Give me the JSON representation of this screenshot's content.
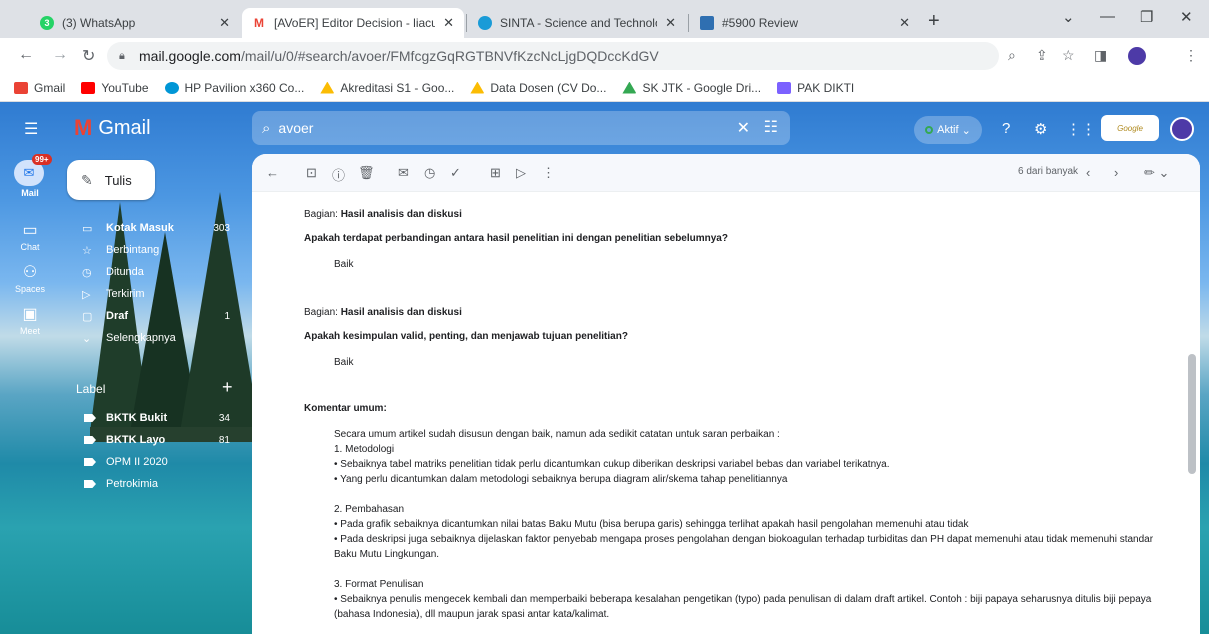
{
  "browser": {
    "tabs": [
      {
        "title": "(3) WhatsApp",
        "favicon": "whatsapp-icon",
        "color": "#25d366"
      },
      {
        "title": "[AVoER] Editor Decision - liacund",
        "favicon": "gmail-icon",
        "color": "#ea4335",
        "active": true
      },
      {
        "title": "SINTA - Science and Technology",
        "favicon": "sinta-icon",
        "color": "#1a9bd7"
      },
      {
        "title": "#5900 Review",
        "favicon": "review-icon",
        "color": "#2f6fb1"
      }
    ],
    "url_host": "mail.google.com",
    "url_path": "/mail/u/0/#search/avoer/FMfcgzGqRGTBNVfKzcNcLjgDQDccKdGV",
    "bookmarks": [
      {
        "label": "Gmail",
        "color": "#ea4335"
      },
      {
        "label": "YouTube",
        "color": "#ff0000"
      },
      {
        "label": "HP Pavilion x360 Co...",
        "color": "#0096d6"
      },
      {
        "label": "Akreditasi S1 - Goo...",
        "color": "#fbbc04"
      },
      {
        "label": "Data Dosen (CV Do...",
        "color": "#fbbc04"
      },
      {
        "label": "SK JTK - Google Dri...",
        "color": "#34a853"
      },
      {
        "label": "PAK DIKTI",
        "color": "#7b61ff"
      }
    ]
  },
  "gmail": {
    "brand": "Gmail",
    "search_query": "avoer",
    "status": "Aktif",
    "compose": "Tulis",
    "rail": {
      "mail": "Mail",
      "mail_count": "99+",
      "chat": "Chat",
      "spaces": "Spaces",
      "meet": "Meet"
    },
    "nav": [
      {
        "label": "Kotak Masuk",
        "count": "303",
        "icon": "inbox-icon",
        "bold": true
      },
      {
        "label": "Berbintang",
        "count": "",
        "icon": "star-icon",
        "bold": false
      },
      {
        "label": "Ditunda",
        "count": "",
        "icon": "clock-icon",
        "bold": false
      },
      {
        "label": "Terkirim",
        "count": "",
        "icon": "send-icon",
        "bold": false
      },
      {
        "label": "Draf",
        "count": "1",
        "icon": "draft-icon",
        "bold": true
      },
      {
        "label": "Selengkapnya",
        "count": "",
        "icon": "chevron-down-icon",
        "bold": false
      }
    ],
    "label_header": "Label",
    "labels": [
      {
        "label": "BKTK Bukit",
        "count": "34",
        "bold": true
      },
      {
        "label": "BKTK Layo",
        "count": "81",
        "bold": true
      },
      {
        "label": "OPM II 2020",
        "count": "",
        "bold": false
      },
      {
        "label": "Petrokimia",
        "count": "",
        "bold": false
      }
    ],
    "pagination": "6 dari banyak"
  },
  "email": {
    "section1_prefix": "Bagian:",
    "section1_title": "Hasil analisis dan diskusi",
    "q1": "Apakah terdapat perbandingan antara hasil penelitian ini dengan penelitian sebelumnya?",
    "a1": "Baik",
    "section2_prefix": "Bagian:",
    "section2_title": "Hasil analisis dan diskusi",
    "q2": "Apakah kesimpulan valid, penting, dan menjawab tujuan penelitian?",
    "a2": "Baik",
    "general_title": "Komentar umum:",
    "general_lines": [
      "Secara umum artikel sudah disusun dengan baik, namun ada sedikit catatan untuk saran perbaikan :",
      "1. Metodologi",
      "• Sebaiknya tabel matriks penelitian tidak perlu dicantumkan cukup diberikan deskripsi variabel bebas dan variabel terikatnya.",
      "• Yang perlu dicantumkan dalam metodologi sebaiknya berupa diagram alir/skema tahap penelitiannya",
      "",
      "2. Pembahasan",
      "• Pada grafik sebaiknya dicantumkan nilai batas Baku Mutu (bisa berupa garis) sehingga terlihat apakah hasil pengolahan memenuhi atau tidak",
      "• Pada deskripsi juga sebaiknya dijelaskan faktor penyebab mengapa proses pengolahan dengan biokoagulan terhadap turbiditas dan PH dapat memenuhi atau tidak memenuhi standar",
      "Baku Mutu Lingkungan.",
      "",
      "3. Format Penulisan",
      "• Sebaiknya penulis mengecek kembali dan memperbaiki beberapa kesalahan pengetikan (typo) pada penulisan di dalam draft artikel. Contoh : biji papaya seharusnya ditulis biji pepaya",
      "(bahasa Indonesia), dll maupun jarak spasi antar kata/kalimat."
    ]
  }
}
